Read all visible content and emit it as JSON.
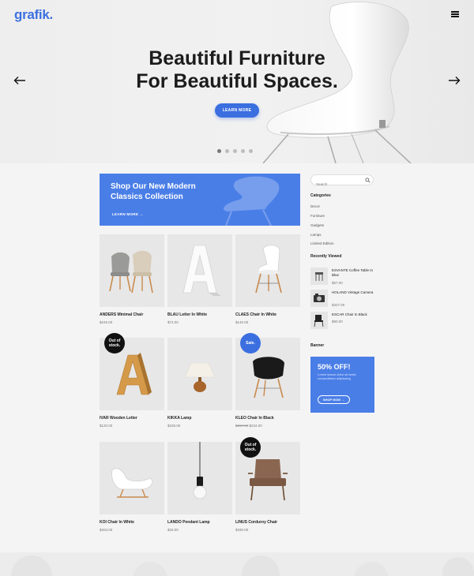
{
  "header": {
    "logo": "grafik."
  },
  "hero": {
    "title_line1": "Beautiful Furniture",
    "title_line2": "For Beautiful Spaces.",
    "button": "LEARN MORE",
    "slides_total": 5,
    "active_slide": 1
  },
  "promo": {
    "title": "Shop Our New Modern Classics Collection",
    "link": "LEARN MORE"
  },
  "products": [
    {
      "name": "ANDERS Minimal Chair",
      "price": "$245.00",
      "old_price": "",
      "badge": ""
    },
    {
      "name": "BLAU Letter In White",
      "price": "$74.00",
      "old_price": "",
      "badge": ""
    },
    {
      "name": "CLAES Chair In White",
      "price": "$140.00",
      "old_price": "",
      "badge": ""
    },
    {
      "name": "IVAR Wooden Letter",
      "price": "$120.00",
      "old_price": "",
      "badge": "Out of stock."
    },
    {
      "name": "KIKKA Lamp",
      "price": "$239.00",
      "old_price": "",
      "badge": ""
    },
    {
      "name": "KLEO Chair In Black",
      "price": "$234.00",
      "old_price": "$267.00",
      "badge": "Sale."
    },
    {
      "name": "KOI Chair In White",
      "price": "$203.00",
      "old_price": "",
      "badge": ""
    },
    {
      "name": "LANDO Pendant Lamp",
      "price": "$33.00",
      "old_price": "",
      "badge": ""
    },
    {
      "name": "LINUS Corduroy Chair",
      "price": "$330.00",
      "old_price": "",
      "badge": "Out of stock."
    }
  ],
  "sidebar": {
    "search_placeholder": "Search",
    "categories_title": "Categories",
    "categories": [
      "Decor",
      "Furniture",
      "Gadgets",
      "Lamps",
      "Limited Edition"
    ],
    "recent_title": "Recently Viewed",
    "recent": [
      {
        "name": "ESVANTE Coffee Table In Blue",
        "price": "$57.00"
      },
      {
        "name": "HOLAND Vintage Camera",
        "price": "$327.00"
      },
      {
        "name": "ESCAR Chair In Black",
        "price": "$90.00"
      }
    ],
    "banner_title": "Banner",
    "banner": {
      "headline": "50% OFF!",
      "text": "Lorem ipsum dolor sit amet, consectetuer adipiscing",
      "button": "SHOP NOW"
    }
  },
  "colors": {
    "accent": "#3b6fe0",
    "promo_bg": "#4a7ee7",
    "badge_dark": "#111111"
  }
}
